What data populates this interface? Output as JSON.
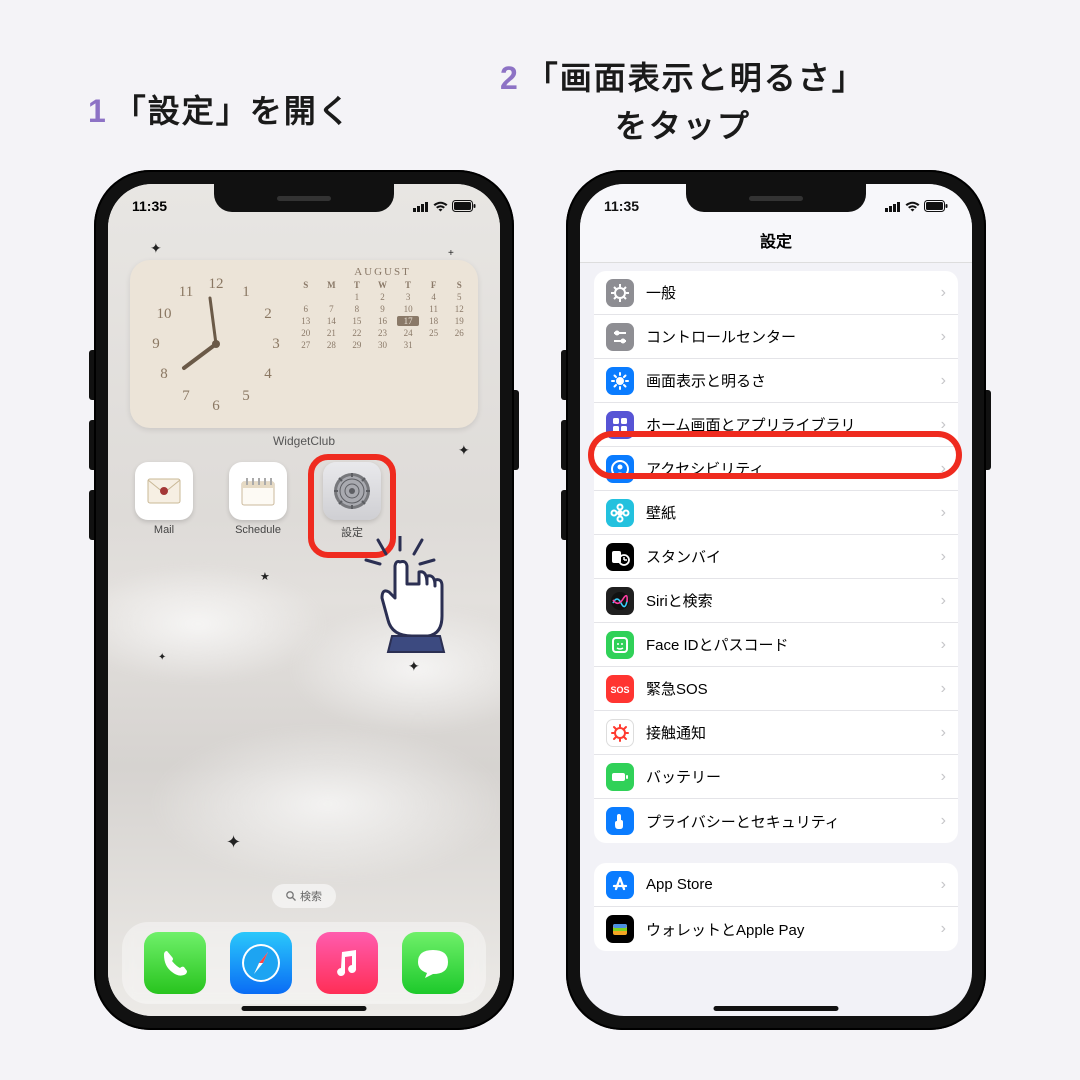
{
  "steps": {
    "s1_num": "1",
    "s1_text": "「設定」を開く",
    "s2_num": "2",
    "s2_line1": "「画面表示と明るさ」",
    "s2_line2": "をタップ"
  },
  "status": {
    "time": "11:35"
  },
  "home": {
    "widget_label": "WidgetClub",
    "cal_month": "AUGUST",
    "cal_days": [
      "S",
      "M",
      "T",
      "W",
      "T",
      "F",
      "S"
    ],
    "cal_highlight": "17",
    "apps": [
      {
        "label": "Mail"
      },
      {
        "label": "Schedule"
      },
      {
        "label": "設定"
      }
    ],
    "search": "検索"
  },
  "settings": {
    "title": "設定",
    "group1": [
      {
        "label": "一般",
        "bg": "#8e8e93",
        "glyph": "gear"
      },
      {
        "label": "コントロールセンター",
        "bg": "#8e8e93",
        "glyph": "sliders"
      },
      {
        "label": "画面表示と明るさ",
        "bg": "#0a7cff",
        "glyph": "sun"
      },
      {
        "label": "ホーム画面とアプリライブラリ",
        "bg": "#5754d5",
        "glyph": "grid"
      },
      {
        "label": "アクセシビリティ",
        "bg": "#0a7cff",
        "glyph": "person"
      },
      {
        "label": "壁紙",
        "bg": "#23c1de",
        "glyph": "flower"
      },
      {
        "label": "スタンバイ",
        "bg": "#000000",
        "glyph": "clock"
      },
      {
        "label": "Siriと検索",
        "bg": "#1f1f1f",
        "glyph": "siri"
      },
      {
        "label": "Face IDとパスコード",
        "bg": "#30d158",
        "glyph": "face"
      },
      {
        "label": "緊急SOS",
        "bg": "#ff3531",
        "glyph": "sos"
      },
      {
        "label": "接触通知",
        "bg": "#ffffff",
        "glyph": "virus"
      },
      {
        "label": "バッテリー",
        "bg": "#30d158",
        "glyph": "battery"
      },
      {
        "label": "プライバシーとセキュリティ",
        "bg": "#0a7cff",
        "glyph": "hand"
      }
    ],
    "group2": [
      {
        "label": "App Store",
        "bg": "#0a7cff",
        "glyph": "appstore"
      },
      {
        "label": "ウォレットとApple Pay",
        "bg": "#000000",
        "glyph": "wallet"
      }
    ]
  }
}
